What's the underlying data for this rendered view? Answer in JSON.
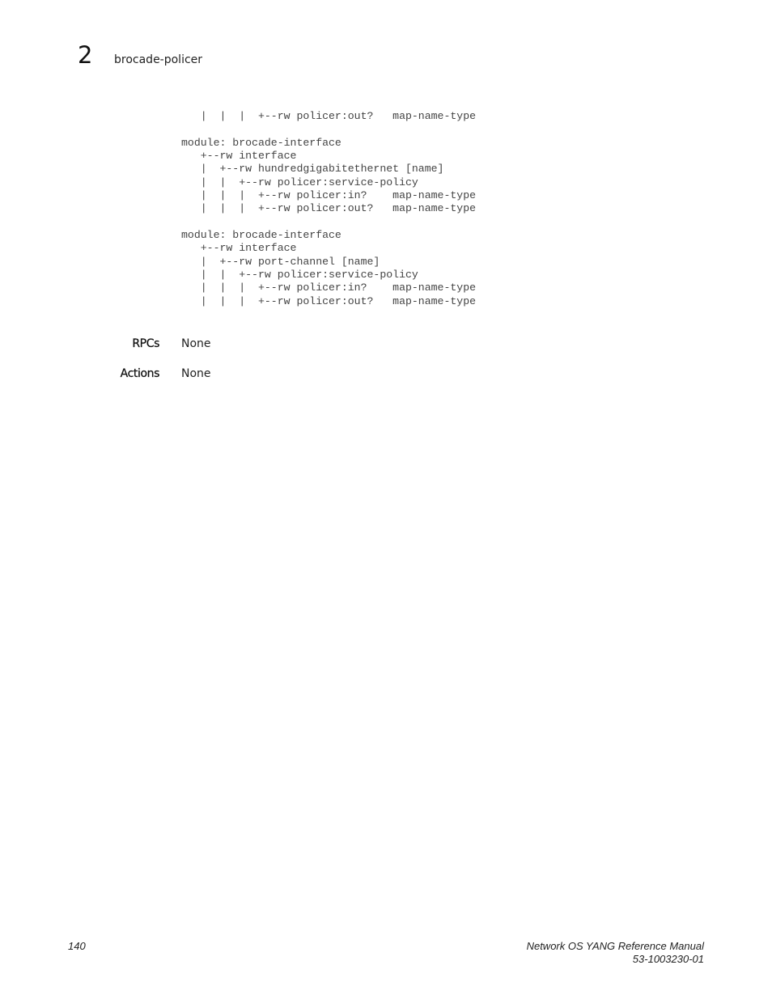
{
  "header": {
    "chapter_number": "2",
    "chapter_title": "brocade-policer"
  },
  "code_lines": [
    "   |  |  |  +--rw policer:out?   map-name-type",
    "",
    "module: brocade-interface",
    "   +--rw interface",
    "   |  +--rw hundredgigabitethernet [name]",
    "   |  |  +--rw policer:service-policy",
    "   |  |  |  +--rw policer:in?    map-name-type",
    "   |  |  |  +--rw policer:out?   map-name-type",
    "",
    "module: brocade-interface",
    "   +--rw interface",
    "   |  +--rw port-channel [name]",
    "   |  |  +--rw policer:service-policy",
    "   |  |  |  +--rw policer:in?    map-name-type",
    "   |  |  |  +--rw policer:out?   map-name-type"
  ],
  "sections": {
    "rpcs": {
      "label": "RPCs",
      "value": "None"
    },
    "actions": {
      "label": "Actions",
      "value": "None"
    }
  },
  "footer": {
    "page_number": "140",
    "manual_title": "Network OS YANG Reference Manual",
    "doc_number": "53-1003230-01"
  }
}
